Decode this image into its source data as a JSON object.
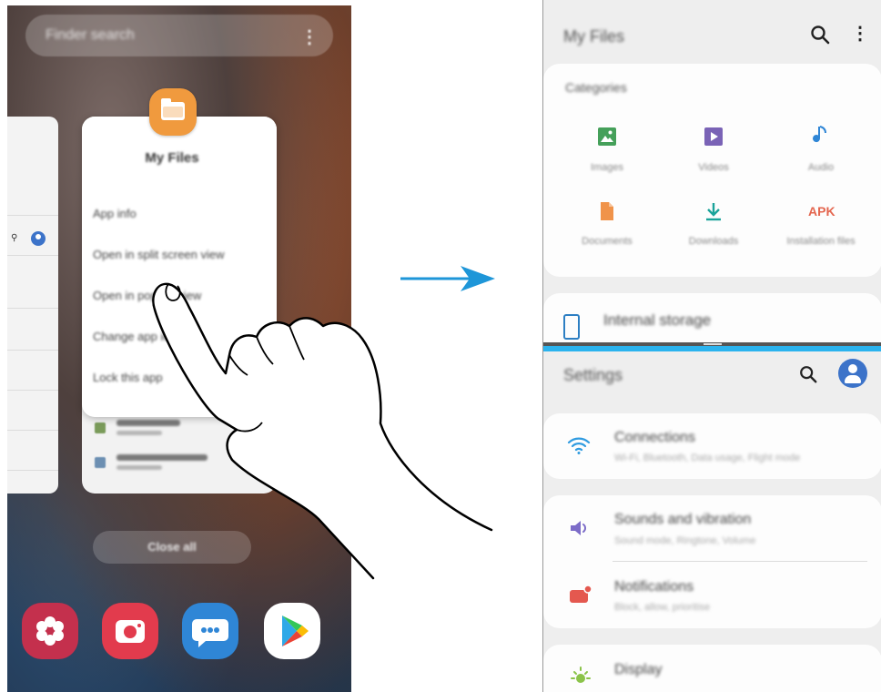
{
  "left_phone": {
    "finder_placeholder": "Finder search",
    "app_name": "My Files",
    "menu": [
      "App info",
      "Open in split screen view",
      "Open in pop-up view",
      "Change app icon",
      "Lock this app"
    ],
    "close_all_label": "Close all",
    "dock_apps": [
      "gallery-icon",
      "camera-icon",
      "messages-icon",
      "play-store-icon"
    ]
  },
  "right_phone": {
    "my_files": {
      "title": "My Files",
      "categories_label": "Categories",
      "categories": [
        {
          "label": "Images",
          "icon": "image-icon",
          "color": "#45a05a"
        },
        {
          "label": "Videos",
          "icon": "video-icon",
          "color": "#7a63b6"
        },
        {
          "label": "Audio",
          "icon": "music-icon",
          "color": "#2f86d6"
        },
        {
          "label": "Documents",
          "icon": "document-icon",
          "color": "#f0934a"
        },
        {
          "label": "Downloads",
          "icon": "download-icon",
          "color": "#1aa39a"
        },
        {
          "label": "Installation files",
          "icon": "apk-icon",
          "color": "#e4664f",
          "badge": "APK"
        }
      ],
      "storage_label": "Internal storage"
    },
    "settings": {
      "title": "Settings",
      "items": [
        {
          "name": "Connections",
          "sub": "Wi-Fi, Bluetooth, Data usage, Flight mode",
          "icon": "wifi-icon"
        },
        {
          "name": "Sounds and vibration",
          "sub": "Sound mode, Ringtone, Volume",
          "icon": "volume-icon"
        },
        {
          "name": "Notifications",
          "sub": "Block, allow, prioritise",
          "icon": "notification-icon"
        },
        {
          "name": "Display",
          "sub": "",
          "icon": "brightness-icon"
        }
      ]
    }
  },
  "colors": {
    "accent_blue": "#2bb3ee",
    "my_files_orange": "#f09a3e",
    "arrow_blue": "#1e96d8"
  }
}
